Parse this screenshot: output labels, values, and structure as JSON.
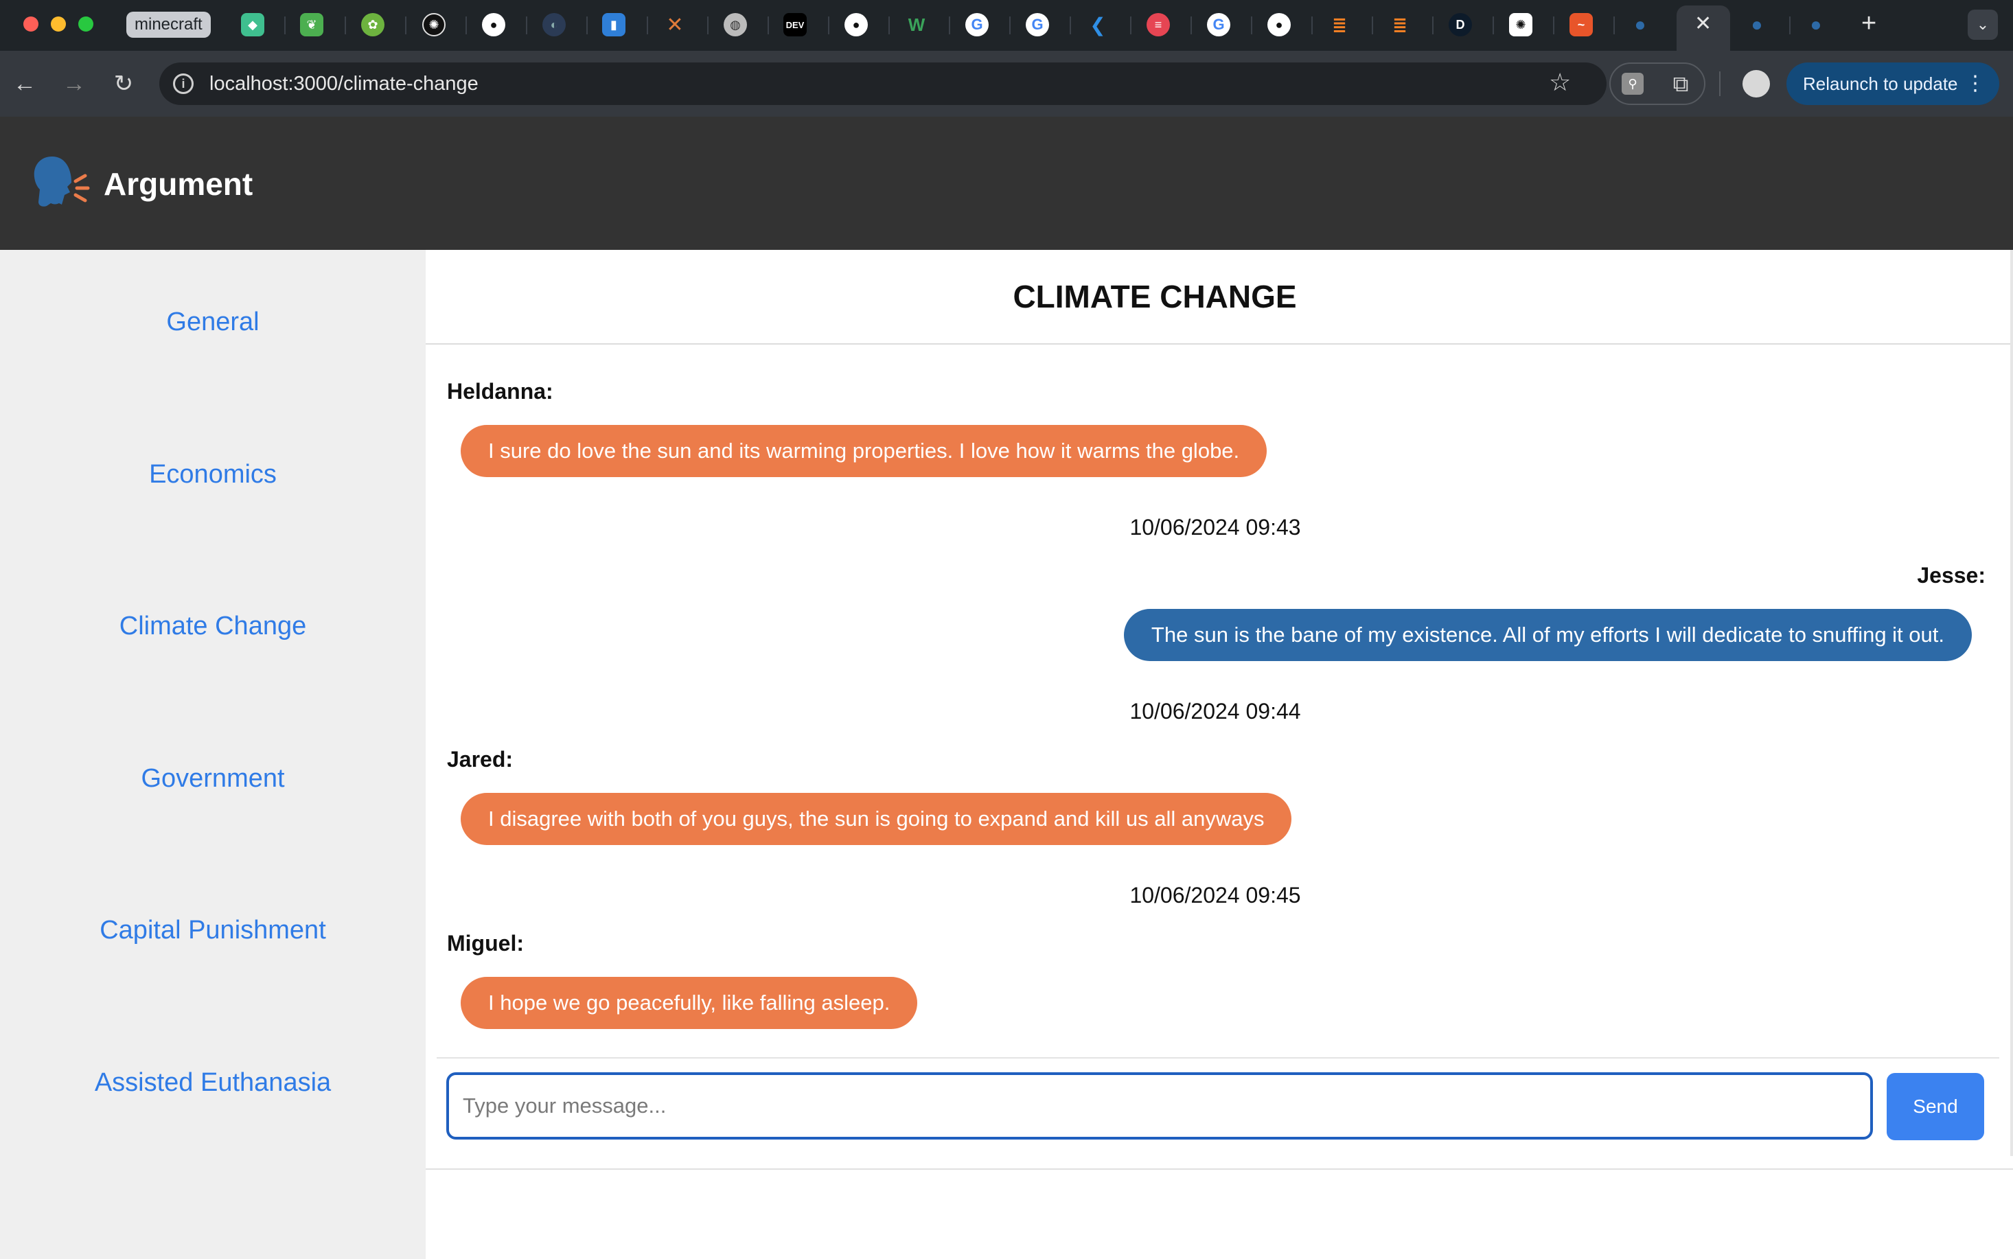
{
  "browser": {
    "tab_title": "minecraft",
    "url": "localhost:3000/climate-change",
    "relaunch_label": "Relaunch to update",
    "tab_favicons": [
      "sketch-icon",
      "leaf-icon",
      "spring-icon",
      "openai-icon",
      "github-icon",
      "dark-globe-icon",
      "bucket-icon",
      "x-orange-icon",
      "globe-icon",
      "dev-icon",
      "github-icon",
      "w-icon",
      "google-icon",
      "google-icon",
      "vscode-icon",
      "red-circle-icon",
      "google-icon",
      "github-icon",
      "stackoverflow-icon",
      "stackoverflow-icon",
      "d-icon",
      "openai-icon",
      "n-orange-icon",
      "argument-icon",
      "argument-icon",
      "argument-icon"
    ],
    "favicon_labels": {
      "dev": "DEV",
      "d": "D",
      "w": "W"
    }
  },
  "app": {
    "title": "Argument",
    "logo": "speaking-head-icon",
    "colors": {
      "header_bg": "#333333",
      "sidebar_bg": "#efefef",
      "link": "#2f7be6",
      "bubble_other": "#ec7c4a",
      "bubble_self": "#2d6aa7",
      "send": "#3b82f0"
    }
  },
  "sidebar": {
    "items": [
      {
        "label": "General"
      },
      {
        "label": "Economics"
      },
      {
        "label": "Climate Change"
      },
      {
        "label": "Government"
      },
      {
        "label": "Capital Punishment"
      },
      {
        "label": "Assisted Euthanasia"
      }
    ]
  },
  "chat": {
    "title": "CLIMATE CHANGE",
    "messages": [
      {
        "author": "Heldanna:",
        "text": "I sure do love the sun and its warming properties. I love how it warms the globe.",
        "timestamp": "10/06/2024 09:43"
      },
      {
        "author": "Jesse:",
        "text": "The sun is the bane of my existence. All of my efforts I will dedicate to snuffing it out.",
        "timestamp": "10/06/2024 09:44"
      },
      {
        "author": "Jared:",
        "text": "I disagree with both of you guys, the sun is going to expand and kill us all anyways",
        "timestamp": "10/06/2024 09:45"
      },
      {
        "author": "Miguel:",
        "text": "I hope we go peacefully, like falling asleep."
      }
    ],
    "input_placeholder": "Type your message...",
    "input_value": "",
    "send_label": "Send"
  }
}
